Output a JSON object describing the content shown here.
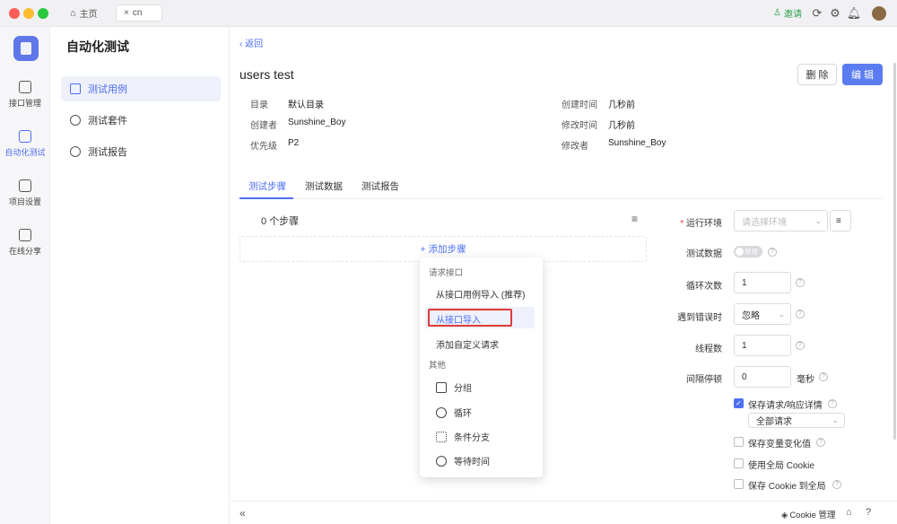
{
  "window": {
    "tabs": [
      {
        "label": "主页"
      },
      {
        "label": "cn"
      }
    ],
    "invite": "邀请"
  },
  "colors": {
    "accent": "#4e6ef2",
    "highlight": "#e03a3a"
  },
  "sidebar": {
    "items": [
      {
        "label": "接口管理",
        "icon": "api-icon"
      },
      {
        "label": "自动化测试",
        "icon": "automation-icon"
      },
      {
        "label": "项目设置",
        "icon": "settings-icon"
      },
      {
        "label": "在线分享",
        "icon": "share-icon"
      }
    ]
  },
  "nav": {
    "title": "自动化测试",
    "items": [
      {
        "label": "测试用例"
      },
      {
        "label": "测试套件"
      },
      {
        "label": "测试报告"
      }
    ]
  },
  "main": {
    "back": "‹ 返回",
    "title": "users test",
    "delete": "删 除",
    "edit": "编 辑",
    "meta": [
      {
        "label": "目录",
        "value": "默认目录"
      },
      {
        "label": "创建者",
        "value": "Sunshine_Boy"
      },
      {
        "label": "优先级",
        "value": "P2"
      },
      {
        "label": "创建时间",
        "value": "几秒前"
      },
      {
        "label": "修改时间",
        "value": "几秒前"
      },
      {
        "label": "修改者",
        "value": "Sunshine_Boy"
      }
    ],
    "tabs": [
      {
        "label": "测试步骤"
      },
      {
        "label": "测试数据"
      },
      {
        "label": "测试报告"
      }
    ],
    "steps_count": "0 个步骤",
    "add_step": "+ 添加步骤"
  },
  "menu": {
    "group1": "请求接口",
    "items1": [
      {
        "label": "从接口用例导入 (推荐)"
      },
      {
        "label": "从接口导入"
      },
      {
        "label": "添加自定义请求"
      }
    ],
    "group2": "其他",
    "items2": [
      {
        "label": "分组",
        "icon": "group-icon"
      },
      {
        "label": "循环",
        "icon": "loop-icon"
      },
      {
        "label": "条件分支",
        "icon": "branch-icon"
      },
      {
        "label": "等待时间",
        "icon": "clock-icon"
      }
    ]
  },
  "settings": {
    "env_label": "运行环境",
    "env_placeholder": "请选择环境",
    "data_label": "测试数据",
    "data_toggle": "禁用",
    "loop_label": "循环次数",
    "loop_value": "1",
    "error_label": "遇到错误时",
    "error_value": "忽略",
    "threads_label": "线程数",
    "threads_value": "1",
    "interval_label": "间隔停顿",
    "interval_value": "0",
    "interval_unit": "毫秒",
    "save_detail": "保存请求/响应详情",
    "save_detail_value": "全部请求",
    "save_var": "保存变量变化值",
    "global_cookie": "使用全局 Cookie",
    "save_cookie": "保存 Cookie 到全局"
  },
  "bottom": {
    "cookie": "Cookie 管理"
  }
}
